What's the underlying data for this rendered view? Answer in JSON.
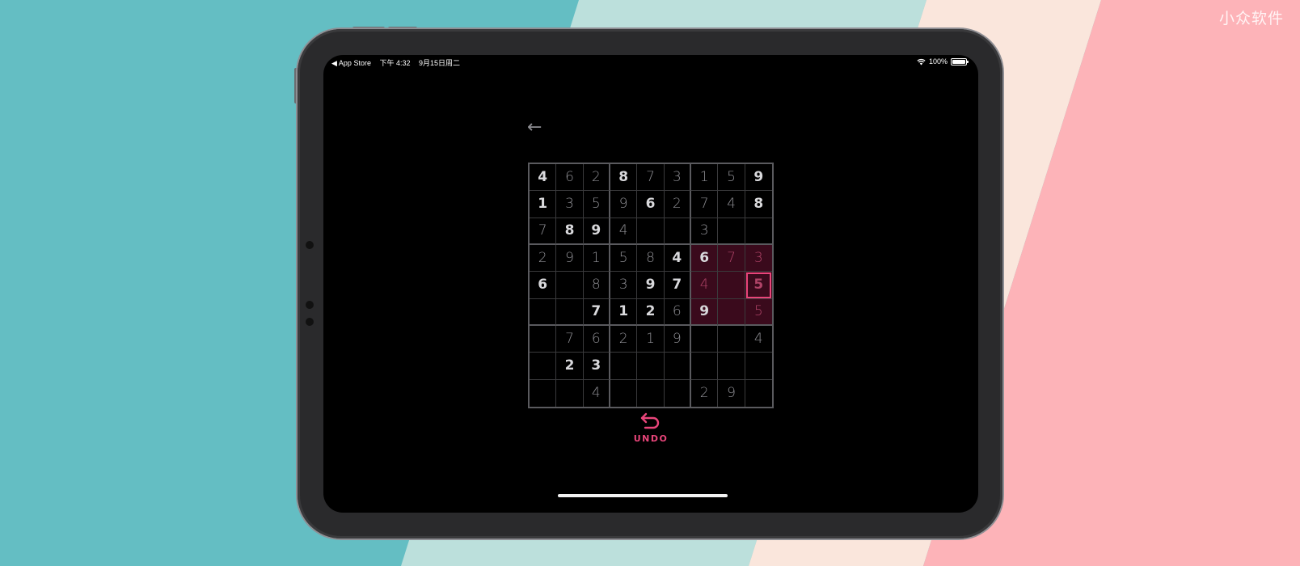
{
  "watermark": "小众软件",
  "status_bar": {
    "back_app": "◀ App Store",
    "time": "下午 4:32",
    "date": "9月15日周二",
    "battery": "100%",
    "battery_level": 1.0
  },
  "icons": {
    "back": "left-arrow-icon",
    "undo": "undo-arrow-icon",
    "wifi": "wifi-icon",
    "battery": "battery-icon"
  },
  "colors": {
    "accent": "#e8457a",
    "highlight": "#3a0a1c",
    "given_digit": "#d9d9dc",
    "entered_digit": "#8e8e93"
  },
  "back_label": "←",
  "undo_label": "UNDO",
  "board": [
    [
      "4",
      "6",
      "2",
      "8",
      "7",
      "3",
      "1",
      "5",
      "9"
    ],
    [
      "1",
      "3",
      "5",
      "9",
      "6",
      "2",
      "7",
      "4",
      "8"
    ],
    [
      "7",
      "8",
      "9",
      "4",
      "",
      "",
      "3",
      "",
      ""
    ],
    [
      "2",
      "9",
      "1",
      "5",
      "8",
      "4",
      "6",
      "7",
      "3"
    ],
    [
      "6",
      "",
      "8",
      "3",
      "9",
      "7",
      "4",
      "",
      "5"
    ],
    [
      "",
      "",
      "7",
      "1",
      "2",
      "6",
      "9",
      "",
      "5"
    ],
    [
      "",
      "7",
      "6",
      "2",
      "1",
      "9",
      "",
      "",
      "4"
    ],
    [
      "",
      "2",
      "3",
      "",
      "",
      "",
      "",
      "",
      ""
    ],
    [
      "",
      "",
      "4",
      "",
      "",
      "",
      "2",
      "9",
      ""
    ]
  ],
  "given": [
    [
      true,
      false,
      false,
      true,
      false,
      false,
      false,
      false,
      true
    ],
    [
      true,
      false,
      false,
      false,
      true,
      false,
      false,
      false,
      true
    ],
    [
      false,
      true,
      true,
      false,
      false,
      false,
      false,
      false,
      false
    ],
    [
      false,
      false,
      false,
      false,
      false,
      true,
      true,
      false,
      false
    ],
    [
      true,
      false,
      false,
      false,
      true,
      true,
      false,
      false,
      false
    ],
    [
      false,
      false,
      true,
      true,
      true,
      false,
      true,
      false,
      false
    ],
    [
      false,
      false,
      false,
      false,
      false,
      false,
      false,
      false,
      false
    ],
    [
      false,
      true,
      true,
      false,
      false,
      false,
      false,
      false,
      false
    ],
    [
      false,
      false,
      false,
      false,
      false,
      false,
      false,
      false,
      false
    ]
  ],
  "selected_cell": {
    "row": 4,
    "col": 8
  },
  "highlighted_box": {
    "row": 1,
    "col": 2
  }
}
